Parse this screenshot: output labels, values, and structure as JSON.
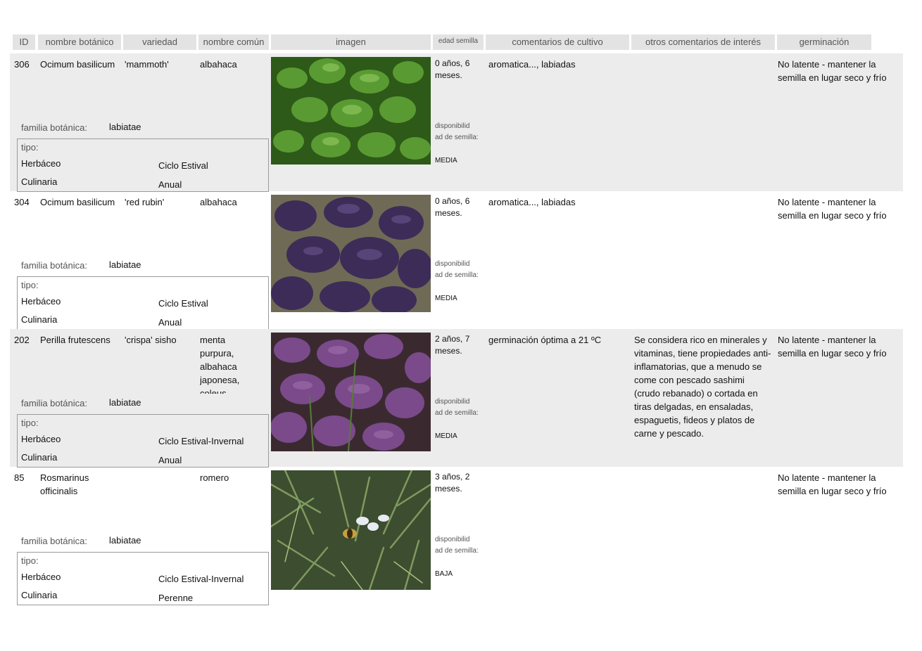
{
  "headers": {
    "id": "ID",
    "botanical_name": "nombre botánico",
    "variety": "variedad",
    "common_name": "nombre común",
    "image": "imagen",
    "seed_age": "edad semilla",
    "cultivation_comments": "comentarios de cultivo",
    "other_comments": "otros comentarios de interés",
    "germination": "germinación"
  },
  "labels": {
    "family": "familia botánica:",
    "type": "tipo:",
    "availability": "disponibilid ad de semilla:"
  },
  "rows": [
    {
      "id": "306",
      "botanical_name": "Ocimum basilicum",
      "variety": "'mammoth'",
      "common_name": "albahaca",
      "family": "labiatae",
      "type1": "Herbáceo",
      "type2": "Culinaria",
      "cycle": "Ciclo Estival",
      "duration": "Anual",
      "seed_age": "0  años, 6 meses.",
      "availability": "MEDIA",
      "cultivation": "aromatica..., labiadas",
      "other": "",
      "germination": "No latente - mantener la semilla en lugar seco y frío",
      "image_alt": "green basil leaves"
    },
    {
      "id": "304",
      "botanical_name": "Ocimum basilicum",
      "variety": "'red rubin'",
      "common_name": "albahaca",
      "family": "labiatae",
      "type1": "Herbáceo",
      "type2": "Culinaria",
      "cycle": "Ciclo Estival",
      "duration": "Anual",
      "seed_age": "0  años, 6 meses.",
      "availability": "MEDIA",
      "cultivation": "aromatica..., labiadas",
      "other": "",
      "germination": "No latente - mantener la semilla en lugar seco y frío",
      "image_alt": "purple basil leaves"
    },
    {
      "id": "202",
      "botanical_name": "Perilla frutescens",
      "variety": "'crispa' sisho",
      "common_name": "menta purpura, albahaca japonesa, coleus",
      "family": "labiatae",
      "type1": "Herbáceo",
      "type2": "Culinaria",
      "cycle": "Ciclo Estival-Invernal",
      "duration": "Anual",
      "seed_age": "2  años, 7 meses.",
      "availability": "MEDIA",
      "cultivation": "germinación óptima  a 21 ºC",
      "other": "Se considera rico en minerales y vitaminas, tiene propiedades anti-inflamatorias, que a menudo se come con pescado sashimi (crudo rebanado) o cortada en tiras delgadas, en ensaladas, espaguetis, fideos y platos de carne y pescado.",
      "germination": "No latente - mantener la semilla en lugar seco y frío",
      "image_alt": "purple perilla leaves"
    },
    {
      "id": "85",
      "botanical_name": "Rosmarinus officinalis",
      "variety": "",
      "common_name": "romero",
      "family": "labiatae",
      "type1": "Herbáceo",
      "type2": "Culinaria",
      "cycle": "Ciclo Estival-Invernal",
      "duration": "Perenne",
      "seed_age": "3  años, 2 meses.",
      "availability": "BAJA",
      "cultivation": "",
      "other": "",
      "germination": "No latente - mantener la semilla en lugar seco y frío",
      "image_alt": "rosemary with a bee on flowers"
    }
  ],
  "colors": {
    "header_bg": "#e3e3e3",
    "row_shade": "#ececec",
    "label_gray": "#555555",
    "basil_green": "#3f7a22",
    "purple_basil": "#4a3566",
    "perilla_purple": "#6e3f7c",
    "rosemary_green": "#4f6b3a"
  }
}
